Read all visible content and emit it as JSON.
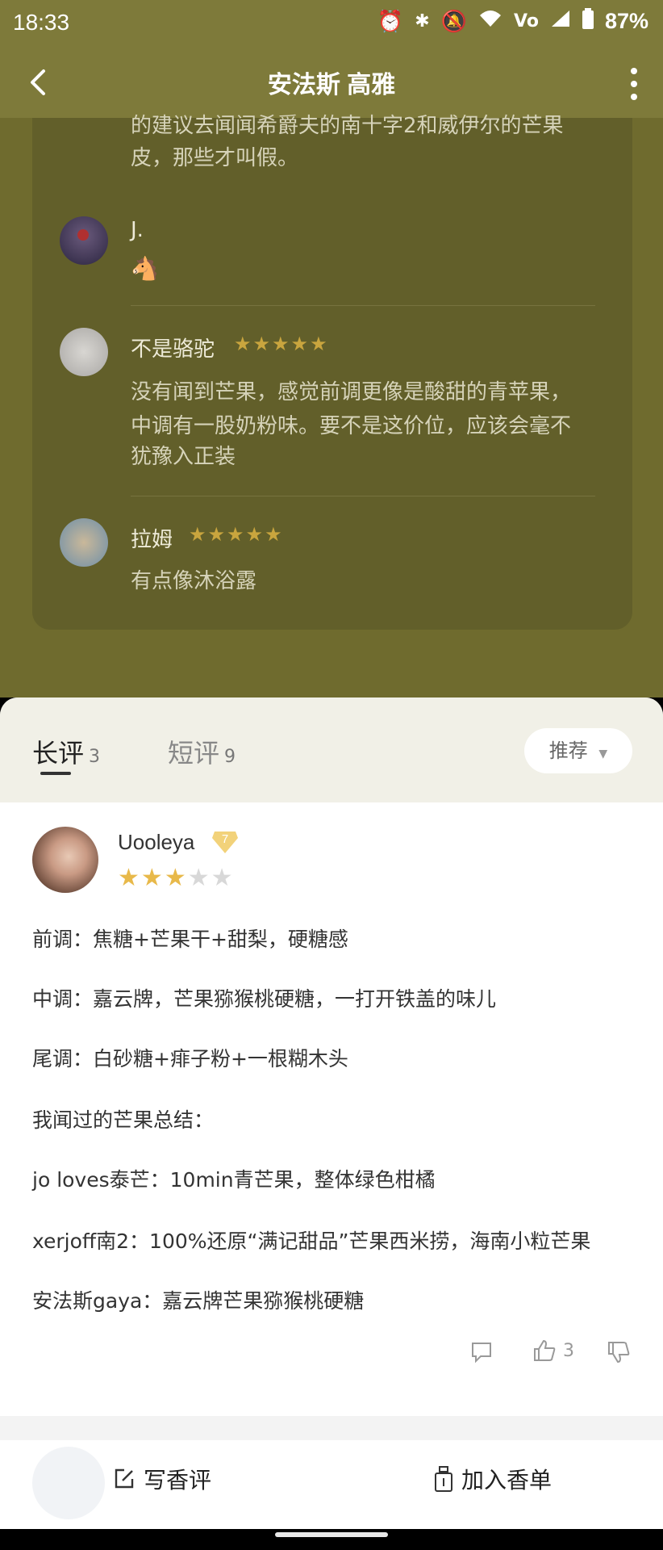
{
  "status": {
    "time": "18:33",
    "battery": "87%",
    "icons": [
      "alarm-icon",
      "bluetooth-icon",
      "mute-icon",
      "wifi-icon",
      "volte-icon",
      "signal-icon",
      "battery-icon"
    ]
  },
  "header": {
    "title": "安法斯 高雅"
  },
  "comments": {
    "partial_text": "的建议去闻闻希爵夫的南十字2和威伊尔的芒果皮，那些才叫假。",
    "partial_text_line1": "的建议去闻闻希爵夫的南十字2和威伊尔的芒果",
    "partial_text_line2": "皮，那些才叫假。",
    "items": [
      {
        "name": "J.",
        "stars": 0,
        "text": "🐴"
      },
      {
        "name": "不是骆驼",
        "stars": 5,
        "text_line1": "没有闻到芒果，感觉前调更像是酸甜的青苹果，",
        "text_line2": "中调有一股奶粉味。要不是这价位，应该会毫不",
        "text_line3": "犹豫入正装"
      },
      {
        "name": "拉姆",
        "stars": 5,
        "text": "有点像沐浴露"
      }
    ]
  },
  "tabs": {
    "long_label": "长评",
    "long_count": "3",
    "short_label": "短评",
    "short_count": "9",
    "sort_label": "推荐"
  },
  "review": {
    "author": "Uooleya",
    "level": "7",
    "rating": 3,
    "rating_max": 5,
    "lines": [
      "前调：焦糖+芒果干+甜梨，硬糖感",
      "中调：嘉云牌，芒果猕猴桃硬糖，一打开铁盖的味儿",
      "尾调：白砂糖+痱子粉+一根糊木头",
      "我闻过的芒果总结：",
      "jo loves泰芒：10min青芒果，整体绿色柑橘",
      "xerjoff南2：100%还原“满记甜品”芒果西米捞，海南小粒芒果",
      "安法斯gaya：嘉云牌芒果猕猴桃硬糖"
    ],
    "like_count": "3"
  },
  "bottom": {
    "write_label": "写香评",
    "add_label": "加入香单"
  },
  "colors": {
    "header_bg": "#7e7a3a",
    "star_gold": "#e8b94a"
  }
}
